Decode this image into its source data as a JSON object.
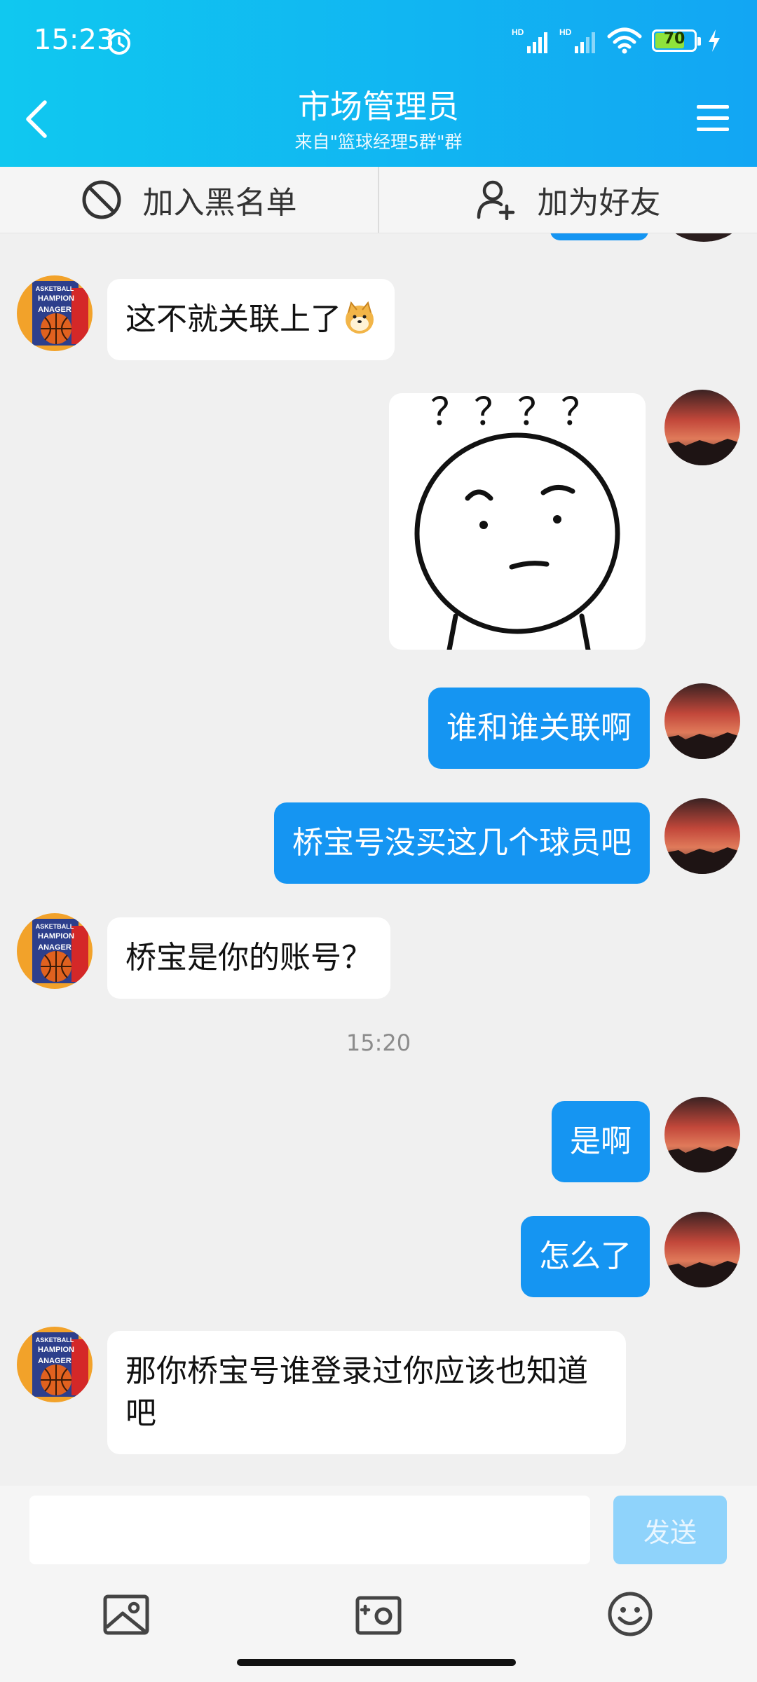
{
  "status_bar": {
    "time": "15:23",
    "network_1": "HD",
    "network_2": "HD",
    "battery": "70"
  },
  "header": {
    "title": "市场管理员",
    "subtitle": "来自\"篮球经理5群\"群"
  },
  "actions": {
    "block_label": "加入黑名单",
    "add_friend_label": "加为好友"
  },
  "messages": [
    {
      "side": "in",
      "type": "text",
      "text": "这不就关联上了"
    },
    {
      "side": "out",
      "type": "sticker",
      "text": "？？？？"
    },
    {
      "side": "out",
      "type": "text",
      "text": "谁和谁关联啊"
    },
    {
      "side": "out",
      "type": "text",
      "text": "桥宝号没买这几个球员吧"
    },
    {
      "side": "in",
      "type": "text",
      "text": "桥宝是你的账号？"
    },
    {
      "type": "timestamp",
      "text": "15:20"
    },
    {
      "side": "out",
      "type": "text",
      "text": "是啊"
    },
    {
      "side": "out",
      "type": "text",
      "text": "怎么了"
    },
    {
      "side": "in",
      "type": "text",
      "text": "那你桥宝号谁登录过你应该也知道吧"
    }
  ],
  "input": {
    "value": "",
    "send_label": "发送"
  },
  "avatar_in_text": {
    "line1": "ASKETBALL",
    "line2": "HAMPION",
    "line3": "ANAGER"
  },
  "colors": {
    "header_start": "#10c8f0",
    "header_end": "#12a6f3",
    "bubble_out": "#1595f2",
    "bubble_in": "#ffffff",
    "send_disabled": "#8fd3fb"
  }
}
